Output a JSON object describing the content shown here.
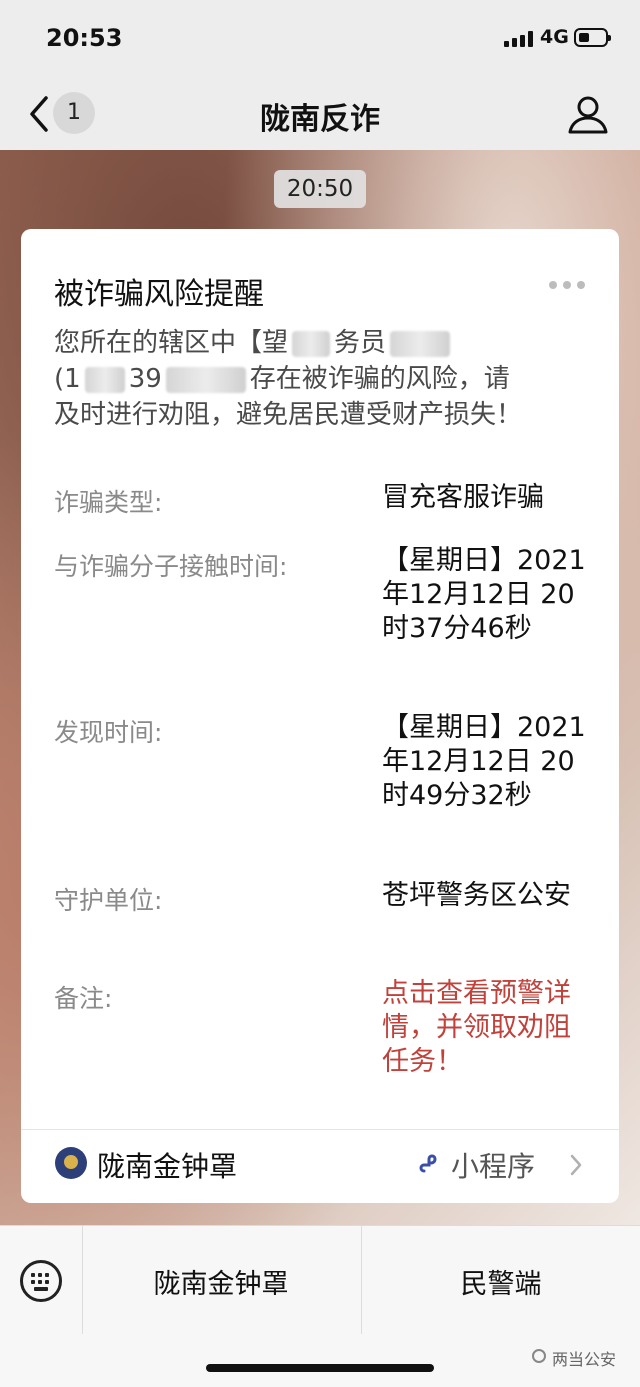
{
  "status_bar": {
    "time": "20:53",
    "network": "4G"
  },
  "nav": {
    "back_count": "1",
    "title": "陇南反诈"
  },
  "chat": {
    "timestamp": "20:50",
    "card": {
      "title": "被诈骗风险提醒",
      "body": {
        "line1_prefix": "您所在的辖区中【望",
        "line1_mid": "务员",
        "line2_prefix": "(1",
        "line2_mid": "39",
        "line2_suffix": "存在被诈骗的风险，请",
        "line3": "及时进行劝阻，避免居民遭受财产损失！"
      },
      "rows": [
        {
          "label": "诈骗类型:",
          "value": "冒充客服诈骗"
        },
        {
          "label": "与诈骗分子接触时间:",
          "value": "【星期日】2021年12月12日 20时37分46秒"
        },
        {
          "label": "发现时间:",
          "value": "【星期日】2021年12月12日 20时49分32秒"
        },
        {
          "label": "守护单位:",
          "value": "苍坪警务区公安"
        },
        {
          "label": "备注:",
          "value": "点击查看预警详情，并领取劝阻任务！"
        }
      ],
      "footer": {
        "app_name": "陇南金钟罩",
        "mini_program": "小程序"
      }
    }
  },
  "bottom_menu": {
    "item1": "陇南金钟罩",
    "item2": "民警端"
  },
  "watermark": "两当公安",
  "colors": {
    "alert_red": "#c0423b",
    "label_gray": "#8a8a8a"
  }
}
